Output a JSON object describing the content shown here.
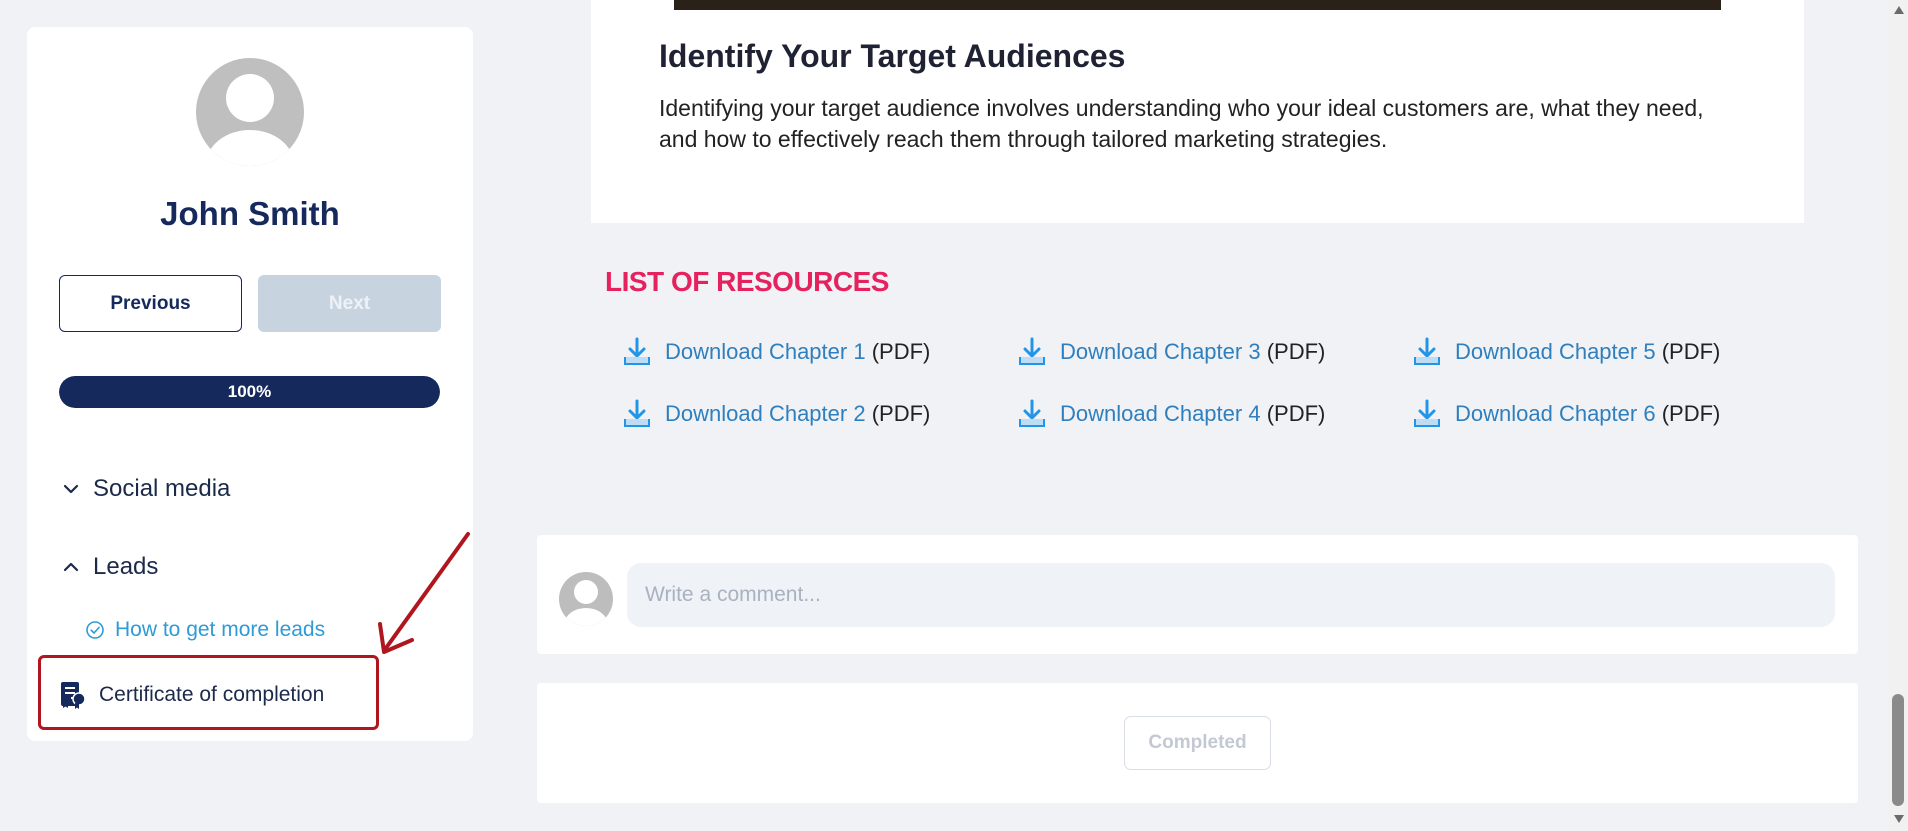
{
  "sidebar": {
    "user_name": "John Smith",
    "previous_label": "Previous",
    "next_label": "Next",
    "progress": {
      "label": "100%",
      "value": 100
    },
    "sections": [
      {
        "title": "Social media",
        "expanded": false,
        "icon": "chevron-down-icon"
      },
      {
        "title": "Leads",
        "expanded": true,
        "icon": "chevron-up-icon",
        "lessons": [
          {
            "title": "How to get more leads",
            "completed": true,
            "icon": "check-circle-icon"
          }
        ]
      }
    ],
    "certificate_label": "Certificate of completion"
  },
  "article": {
    "title": "Identify Your Target Audiences",
    "text": "Identifying your target audience involves understanding who your ideal customers are, what they need, and how to effectively reach them through tailored marketing strategies."
  },
  "resources": {
    "title": "LIST OF RESOURCES",
    "items": [
      {
        "link": "Download Chapter 1",
        "suffix": "(PDF)"
      },
      {
        "link": "Download Chapter 2",
        "suffix": "(PDF)"
      },
      {
        "link": "Download Chapter 3",
        "suffix": "(PDF)"
      },
      {
        "link": "Download Chapter 4",
        "suffix": "(PDF)"
      },
      {
        "link": "Download Chapter 5",
        "suffix": "(PDF)"
      },
      {
        "link": "Download Chapter 6",
        "suffix": "(PDF)"
      }
    ]
  },
  "comments": {
    "placeholder": "Write a comment..."
  },
  "completion": {
    "button_label": "Completed"
  },
  "colors": {
    "brand_navy": "#16295c",
    "accent_pink": "#e5225e",
    "link_blue": "#2f7fbe",
    "annotation_red": "#b0161e"
  }
}
